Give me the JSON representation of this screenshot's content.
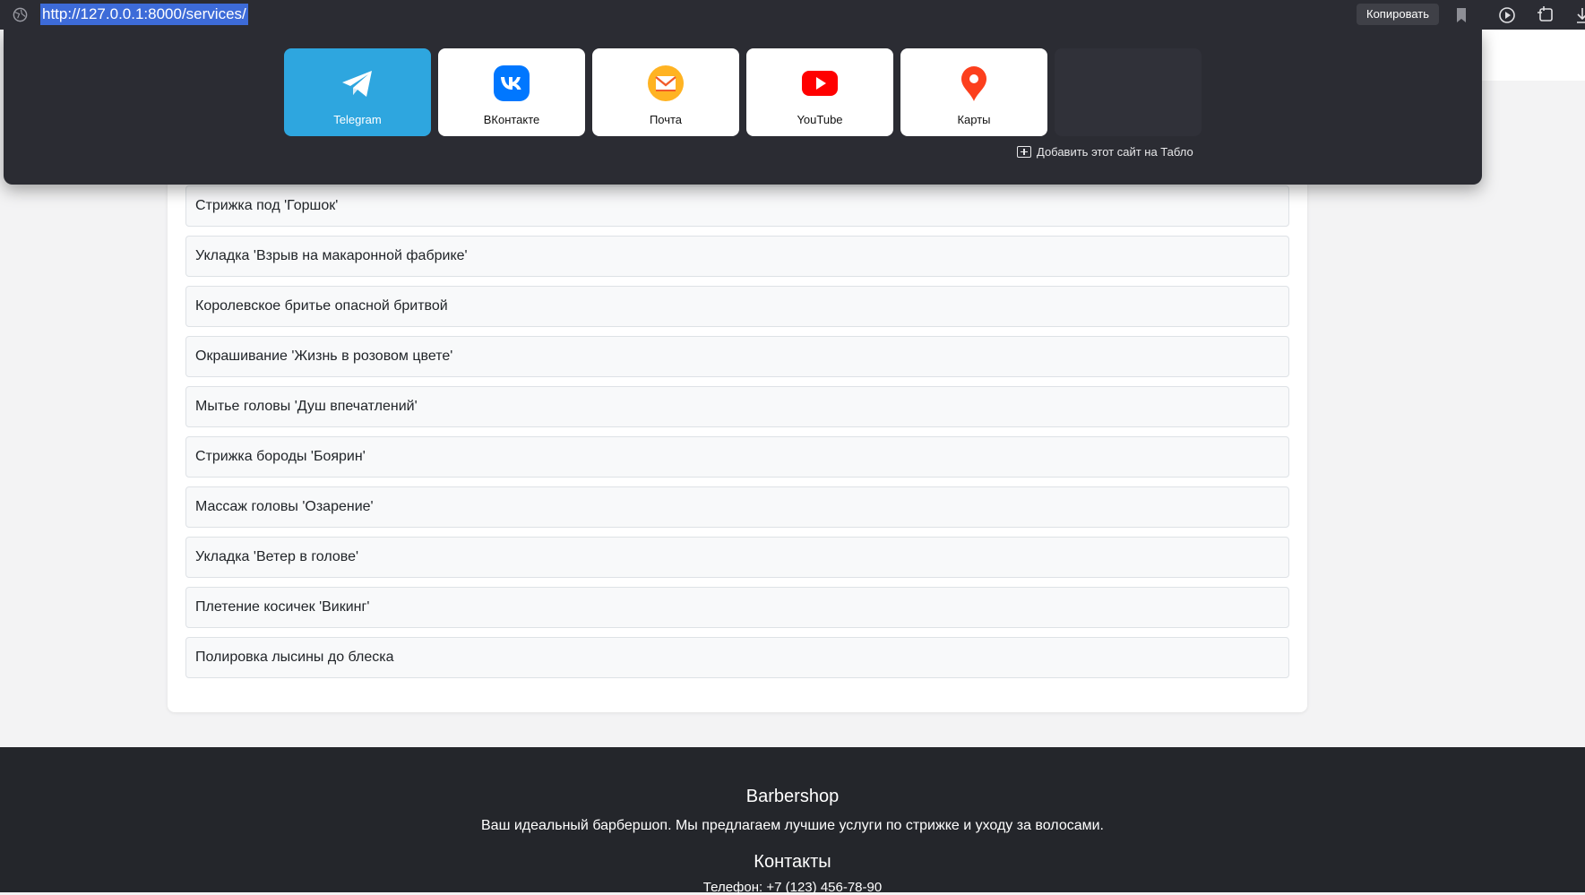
{
  "browser": {
    "url": "http://127.0.0.1:8000/services/",
    "copy_label": "Копировать"
  },
  "speed_dial": {
    "tiles": [
      {
        "label": "Telegram",
        "icon": "telegram-icon"
      },
      {
        "label": "ВКонтакте",
        "icon": "vk-icon"
      },
      {
        "label": "Почта",
        "icon": "mail-icon"
      },
      {
        "label": "YouTube",
        "icon": "youtube-icon"
      },
      {
        "label": "Карты",
        "icon": "maps-pin-icon"
      }
    ],
    "add_site_label": "Добавить этот сайт на Табло"
  },
  "services": [
    "Стрижка под 'Горшок'",
    "Укладка 'Взрыв на макаронной фабрике'",
    "Королевское бритье опасной бритвой",
    "Окрашивание 'Жизнь в розовом цвете'",
    "Мытье головы 'Душ впечатлений'",
    "Стрижка бороды 'Боярин'",
    "Массаж головы 'Озарение'",
    "Укладка 'Ветер в голове'",
    "Плетение косичек 'Викинг'",
    "Полировка лысины до блеска"
  ],
  "footer": {
    "title": "Barbershop",
    "description": "Ваш идеальный барбершоп. Мы предлагаем лучшие услуги по стрижке и уходу за волосами.",
    "contacts_title": "Контакты",
    "phone": "Телефон: +7 (123) 456-78-90"
  },
  "colors": {
    "browser_bar": "#2b2c33",
    "url_selection": "#3d6bd8",
    "telegram_tile": "#2ea6df",
    "footer_bg": "#24262b",
    "page_bg": "#f3f3f4"
  }
}
